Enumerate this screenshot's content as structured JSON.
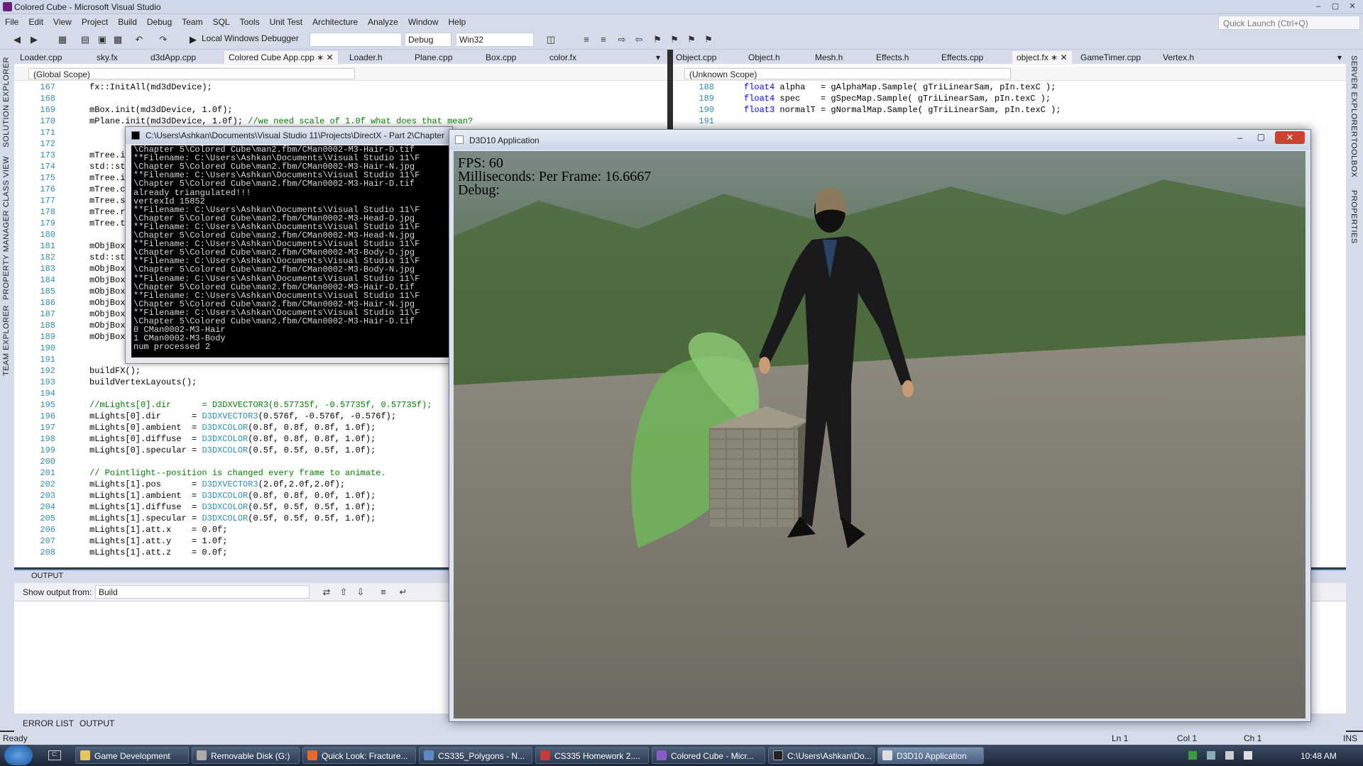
{
  "window": {
    "title": "Colored Cube - Microsoft Visual Studio"
  },
  "menu": [
    "File",
    "Edit",
    "View",
    "Project",
    "Build",
    "Debug",
    "Team",
    "SQL",
    "Tools",
    "Unit Test",
    "Architecture",
    "Analyze",
    "Window",
    "Help"
  ],
  "quick_launch": {
    "placeholder": "Quick Launch (Ctrl+Q)"
  },
  "toolbar": {
    "debugger_label": "Local Windows Debugger",
    "config": "Debug",
    "platform": "Win32"
  },
  "left_strip": [
    "SOLUTION EXPLORER",
    "CLASS VIEW",
    "PROPERTY MANAGER",
    "TEAM EXPLORER"
  ],
  "right_strip": [
    "SERVER EXPLORER",
    "TOOLBOX",
    "PROPERTIES"
  ],
  "left_editor": {
    "tabs": [
      "Loader.cpp",
      "sky.fx",
      "d3dApp.cpp",
      "Colored Cube App.cpp",
      "Loader.h",
      "Plane.cpp",
      "Box.cpp",
      "color.fx"
    ],
    "active_tab": "Colored Cube App.cpp",
    "scope": "(Global Scope)",
    "lines": [
      {
        "n": "167",
        "t": "fx::InitAll(md3dDevice);"
      },
      {
        "n": "168",
        "t": ""
      },
      {
        "n": "169",
        "t": "mBox.init(md3dDevice, 1.0f);"
      },
      {
        "n": "170",
        "t": "mPlane.init(md3dDevice, 1.0f); //we need scale of 1.0f what does that mean?"
      },
      {
        "n": "171",
        "t": ""
      },
      {
        "n": "172",
        "t": ""
      },
      {
        "n": "173",
        "t": "mTree.i"
      },
      {
        "n": "174",
        "t": "std::st"
      },
      {
        "n": "175",
        "t": "mTree.i"
      },
      {
        "n": "176",
        "t": "mTree.c"
      },
      {
        "n": "177",
        "t": "mTree.s"
      },
      {
        "n": "178",
        "t": "mTree.r"
      },
      {
        "n": "179",
        "t": "mTree.t"
      },
      {
        "n": "180",
        "t": ""
      },
      {
        "n": "181",
        "t": "mObjBox"
      },
      {
        "n": "182",
        "t": "std::st"
      },
      {
        "n": "183",
        "t": "mObjBox"
      },
      {
        "n": "184",
        "t": "mObjBox"
      },
      {
        "n": "185",
        "t": "mObjBox"
      },
      {
        "n": "186",
        "t": "mObjBox"
      },
      {
        "n": "187",
        "t": "mObjBox"
      },
      {
        "n": "188",
        "t": "mObjBox"
      },
      {
        "n": "189",
        "t": "mObjBox"
      },
      {
        "n": "190",
        "t": ""
      },
      {
        "n": "191",
        "t": ""
      },
      {
        "n": "192",
        "t": "buildFX();"
      },
      {
        "n": "193",
        "t": "buildVertexLayouts();"
      },
      {
        "n": "194",
        "t": ""
      },
      {
        "n": "195",
        "t": "//mLights[0].dir      = D3DXVECTOR3(0.57735f, -0.57735f, 0.57735f);"
      },
      {
        "n": "196",
        "t": "mLights[0].dir      = D3DXVECTOR3(0.576f, -0.576f, -0.576f);"
      },
      {
        "n": "197",
        "t": "mLights[0].ambient  = D3DXCOLOR(0.8f, 0.8f, 0.8f, 1.0f);"
      },
      {
        "n": "198",
        "t": "mLights[0].diffuse  = D3DXCOLOR(0.8f, 0.8f, 0.8f, 1.0f);"
      },
      {
        "n": "199",
        "t": "mLights[0].specular = D3DXCOLOR(0.5f, 0.5f, 0.5f, 1.0f);"
      },
      {
        "n": "200",
        "t": ""
      },
      {
        "n": "201",
        "t": "// Pointlight--position is changed every frame to animate."
      },
      {
        "n": "202",
        "t": "mLights[1].pos      = D3DXVECTOR3(2.0f,2.0f,2.0f);"
      },
      {
        "n": "203",
        "t": "mLights[1].ambient  = D3DXCOLOR(0.8f, 0.8f, 0.0f, 1.0f);"
      },
      {
        "n": "204",
        "t": "mLights[1].diffuse  = D3DXCOLOR(0.5f, 0.5f, 0.5f, 1.0f);"
      },
      {
        "n": "205",
        "t": "mLights[1].specular = D3DXCOLOR(0.5f, 0.5f, 0.5f, 1.0f);"
      },
      {
        "n": "206",
        "t": "mLights[1].att.x    = 0.0f;"
      },
      {
        "n": "207",
        "t": "mLights[1].att.y    = 1.0f;"
      },
      {
        "n": "208",
        "t": "mLights[1].att.z    = 0.0f;"
      }
    ]
  },
  "right_editor": {
    "tabs": [
      "Object.cpp",
      "Object.h",
      "Mesh.h",
      "Effects.h",
      "Effects.cpp",
      "object.fx",
      "GameTimer.cpp",
      "Vertex.h"
    ],
    "active_tab": "object.fx",
    "scope": "(Unknown Scope)",
    "lines": [
      {
        "n": "188",
        "t": "float4 alpha   = gAlphaMap.Sample( gTriLinearSam, pIn.texC );"
      },
      {
        "n": "189",
        "t": "float4 spec    = gSpecMap.Sample( gTriLinearSam, pIn.texC );"
      },
      {
        "n": "190",
        "t": "float3 normalT = gNormalMap.Sample( gTriLinearSam, pIn.texC );"
      },
      {
        "n": "191",
        "t": ""
      }
    ]
  },
  "console": {
    "title": "C:\\Users\\Ashkan\\Documents\\Visual Studio 11\\Projects\\DirectX - Part 2\\Chapter",
    "lines": [
      "\\Chapter 5\\Colored Cube\\man2.fbm/CMan0002-M3-Hair-D.tif",
      "**Filename: C:\\Users\\Ashkan\\Documents\\Visual Studio 11\\F",
      "\\Chapter 5\\Colored Cube\\man2.fbm/CMan0002-M3-Hair-N.jpg",
      "**Filename: C:\\Users\\Ashkan\\Documents\\Visual Studio 11\\F",
      "\\Chapter 5\\Colored Cube\\man2.fbm/CMan0002-M3-Hair-D.tif",
      "already triangulated!!!",
      "vertexId 15852",
      "**Filename: C:\\Users\\Ashkan\\Documents\\Visual Studio 11\\F",
      "\\Chapter 5\\Colored Cube\\man2.fbm/CMan0002-M3-Head-D.jpg",
      "**Filename: C:\\Users\\Ashkan\\Documents\\Visual Studio 11\\F",
      "\\Chapter 5\\Colored Cube\\man2.fbm/CMan0002-M3-Head-N.jpg",
      "**Filename: C:\\Users\\Ashkan\\Documents\\Visual Studio 11\\F",
      "\\Chapter 5\\Colored Cube\\man2.fbm/CMan0002-M3-Body-D.jpg",
      "**Filename: C:\\Users\\Ashkan\\Documents\\Visual Studio 11\\F",
      "\\Chapter 5\\Colored Cube\\man2.fbm/CMan0002-M3-Body-N.jpg",
      "**Filename: C:\\Users\\Ashkan\\Documents\\Visual Studio 11\\F",
      "\\Chapter 5\\Colored Cube\\man2.fbm/CMan0002-M3-Hair-D.tif",
      "**Filename: C:\\Users\\Ashkan\\Documents\\Visual Studio 11\\F",
      "\\Chapter 5\\Colored Cube\\man2.fbm/CMan0002-M3-Hair-N.jpg",
      "**Filename: C:\\Users\\Ashkan\\Documents\\Visual Studio 11\\F",
      "\\Chapter 5\\Colored Cube\\man2.fbm/CMan0002-M3-Hair-D.tif",
      "0 CMan0002-M3-Hair",
      "1 CMan0002-M3-Body",
      "num processed 2"
    ]
  },
  "d3d": {
    "title": "D3D10 Application",
    "fps": "FPS: 60",
    "ms": "Milliseconds: Per Frame: 16.6667",
    "debug": "Debug:"
  },
  "output": {
    "title": "OUTPUT",
    "show_from_label": "Show output from:",
    "source": "Build"
  },
  "bottom_tabs": [
    "ERROR LIST",
    "OUTPUT"
  ],
  "status": {
    "text": "Ready",
    "ln": "Ln 1",
    "col": "Col 1",
    "ch": "Ch 1",
    "ins": "INS"
  },
  "taskbar": {
    "items": [
      "Game Development",
      "Removable Disk (G:)",
      "Quick Look: Fracture...",
      "CS335_Polygons - N...",
      "CS335 Homework 2....",
      "Colored Cube - Micr...",
      "C:\\Users\\Ashkan\\Do...",
      "D3D10 Application"
    ],
    "clock": "10:48 AM"
  }
}
